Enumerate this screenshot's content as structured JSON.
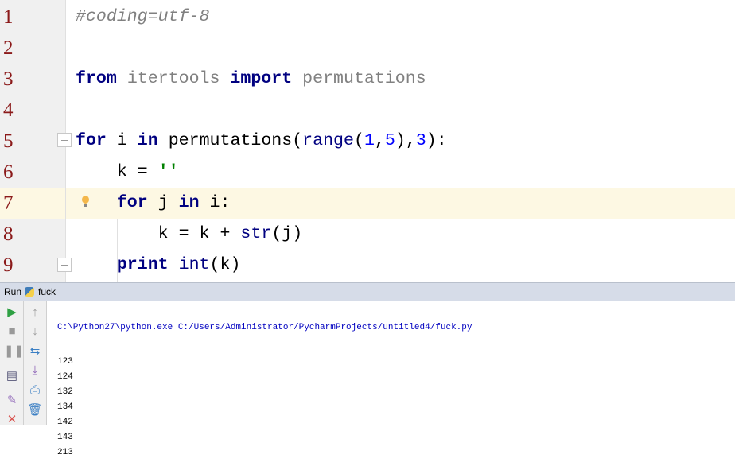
{
  "editor": {
    "lines": [
      {
        "n": "1",
        "code": "#coding=utf-8"
      },
      {
        "n": "2",
        "code": ""
      },
      {
        "n": "3",
        "code": "from itertools import permutations"
      },
      {
        "n": "4",
        "code": ""
      },
      {
        "n": "5",
        "code": "for i in permutations(range(1,5),3):"
      },
      {
        "n": "6",
        "code": "    k = ''"
      },
      {
        "n": "7",
        "code": "    for j in i:"
      },
      {
        "n": "8",
        "code": "        k = k + str(j)"
      },
      {
        "n": "9",
        "code": "    print int(k)"
      }
    ]
  },
  "run": {
    "label": "Run",
    "config": "fuck"
  },
  "console": {
    "command": "C:\\Python27\\python.exe C:/Users/Administrator/PycharmProjects/untitled4/fuck.py",
    "output": [
      "123",
      "124",
      "132",
      "134",
      "142",
      "143",
      "213"
    ]
  },
  "colors": {
    "keyword": "#000080",
    "number": "#0000ff",
    "string": "#008000",
    "comment": "#808080",
    "line_number": "#8b1a1a",
    "current_line": "#fdf8e3",
    "command": "#0000c0"
  }
}
